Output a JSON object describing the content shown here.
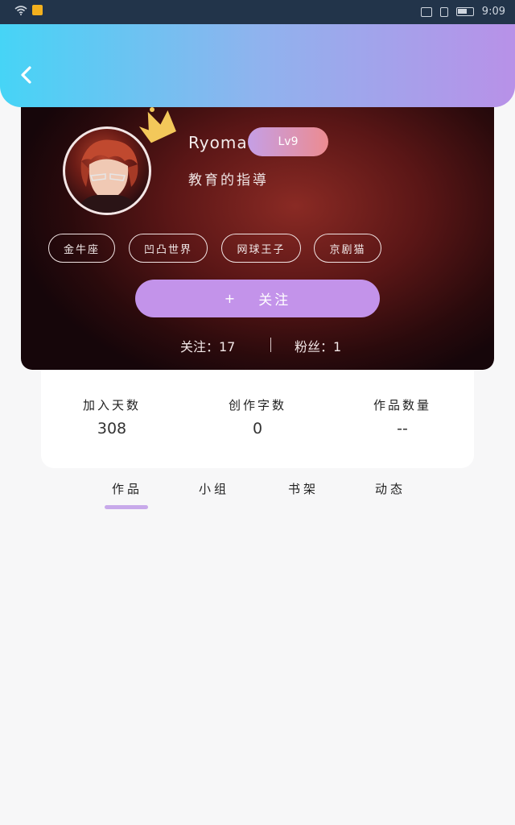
{
  "status_bar": {
    "time": "9:09"
  },
  "profile": {
    "username": "Ryomae",
    "level": "Lv9",
    "motto": "教育的指導",
    "tags": [
      "金牛座",
      "凹凸世界",
      "网球王子",
      "京剧猫"
    ],
    "follow_button": {
      "icon": "+",
      "label": "关注"
    },
    "following": "关注：17",
    "fans": "粉丝：1"
  },
  "stats": [
    {
      "label": "加入天数",
      "value": "308"
    },
    {
      "label": "创作字数",
      "value": "0"
    },
    {
      "label": "作品数量",
      "value": "--"
    }
  ],
  "tabs": [
    "作品",
    "小组",
    "书架",
    "动态"
  ],
  "colors": {
    "header_start": "#46d4f6",
    "header_end": "#b891e8",
    "accent_purple": "#c393ea",
    "level_start": "#c59fe6",
    "level_end": "#ec8b90",
    "crown": "#f3c85a"
  },
  "icons": {
    "back": "chevron-left-icon",
    "crown": "crown-icon"
  }
}
